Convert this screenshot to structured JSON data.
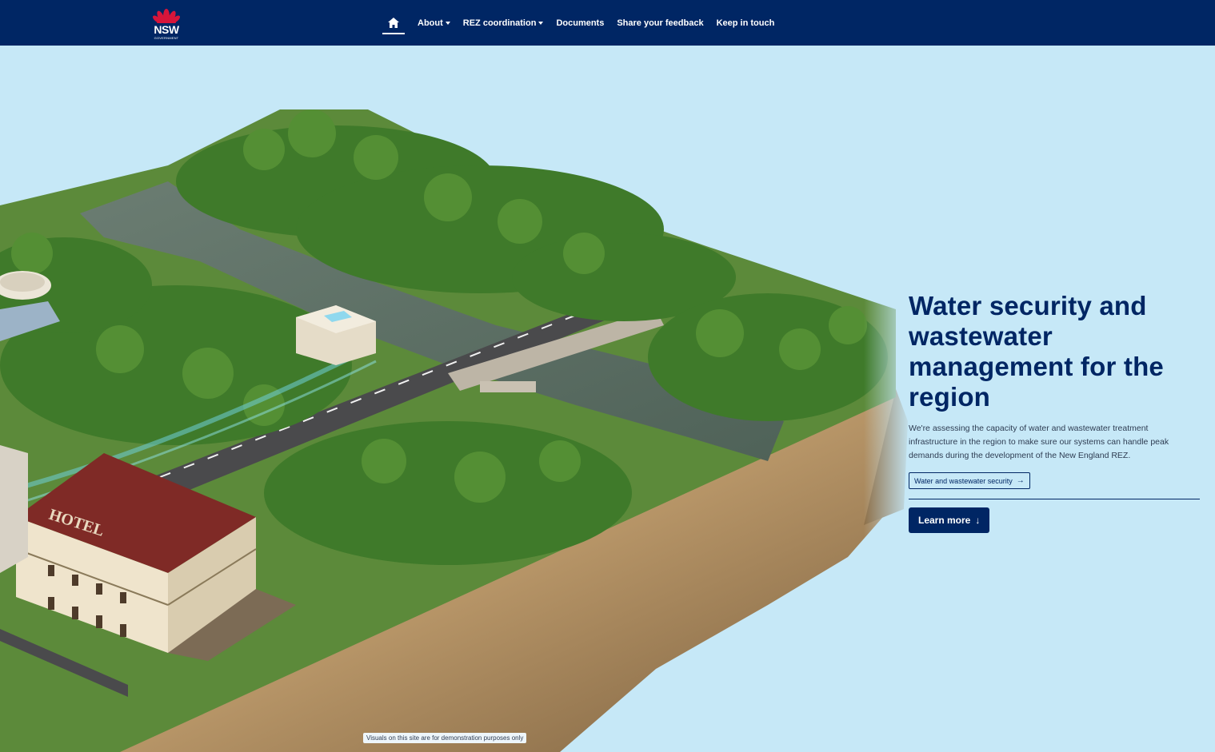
{
  "nav": {
    "logo_text": "NSW",
    "logo_sub": "GOVERNMENT",
    "items": [
      {
        "label": "About"
      },
      {
        "label": "REZ coordination"
      },
      {
        "label": "Documents"
      },
      {
        "label": "Share your feedback"
      },
      {
        "label": "Keep in touch"
      }
    ]
  },
  "scene": {
    "hotel_sign": "HOTEL"
  },
  "hero": {
    "title": "Water security and wastewater management for the region",
    "description": "We're assessing the capacity of water and wastewater treatment infrastructure in the region to make sure our systems can handle peak demands during the development of the New England REZ.",
    "tag_label": "Water and wastewater security",
    "button_label": "Learn more"
  },
  "disclaimer": "Visuals on this site are for demonstration purposes only",
  "colors": {
    "nav_bg": "#002664",
    "sky": "#c6e8f7",
    "title": "#002664",
    "logo_red": "#d7153a"
  }
}
